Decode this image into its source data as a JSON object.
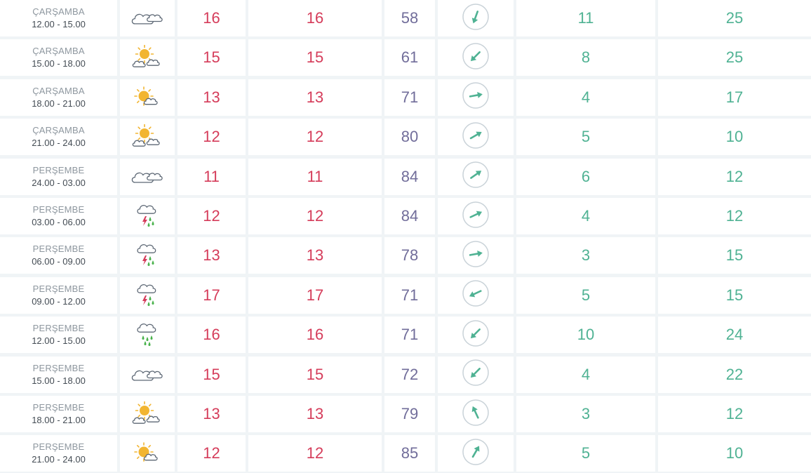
{
  "colors": {
    "temperature": "#d53c5a",
    "humidity": "#716d9a",
    "wind": "#4fb293",
    "sun": "#f2b531",
    "cloud_outline": "#5c6774",
    "rain": "#49b24b",
    "lightning": "#d53c5a"
  },
  "rows": [
    {
      "day": "ÇARŞAMBA",
      "hours": "12.00 - 15.00",
      "icon": "cloudy-icon",
      "temp": "16",
      "feels": "16",
      "humidity": "58",
      "wind_deg": 200,
      "wind": "11",
      "gust": "25"
    },
    {
      "day": "ÇARŞAMBA",
      "hours": "15.00 - 18.00",
      "icon": "partly-cloudy-icon",
      "temp": "15",
      "feels": "15",
      "humidity": "61",
      "wind_deg": 225,
      "wind": "8",
      "gust": "25"
    },
    {
      "day": "ÇARŞAMBA",
      "hours": "18.00 - 21.00",
      "icon": "sun-cloud-icon",
      "temp": "13",
      "feels": "13",
      "humidity": "71",
      "wind_deg": 80,
      "wind": "4",
      "gust": "17"
    },
    {
      "day": "ÇARŞAMBA",
      "hours": "21.00 - 24.00",
      "icon": "partly-cloudy-icon",
      "temp": "12",
      "feels": "12",
      "humidity": "80",
      "wind_deg": 60,
      "wind": "5",
      "gust": "10"
    },
    {
      "day": "PERŞEMBE",
      "hours": "24.00 - 03.00",
      "icon": "cloudy-icon",
      "temp": "11",
      "feels": "11",
      "humidity": "84",
      "wind_deg": 55,
      "wind": "6",
      "gust": "12"
    },
    {
      "day": "PERŞEMBE",
      "hours": "03.00 - 06.00",
      "icon": "thunder-rain-icon",
      "temp": "12",
      "feels": "12",
      "humidity": "84",
      "wind_deg": 65,
      "wind": "4",
      "gust": "12"
    },
    {
      "day": "PERŞEMBE",
      "hours": "06.00 - 09.00",
      "icon": "thunder-rain-icon",
      "temp": "13",
      "feels": "13",
      "humidity": "78",
      "wind_deg": 80,
      "wind": "3",
      "gust": "15"
    },
    {
      "day": "PERŞEMBE",
      "hours": "09.00 - 12.00",
      "icon": "thunder-rain-icon",
      "temp": "17",
      "feels": "17",
      "humidity": "71",
      "wind_deg": 245,
      "wind": "5",
      "gust": "15"
    },
    {
      "day": "PERŞEMBE",
      "hours": "12.00 - 15.00",
      "icon": "rain-icon",
      "temp": "16",
      "feels": "16",
      "humidity": "71",
      "wind_deg": 225,
      "wind": "10",
      "gust": "24"
    },
    {
      "day": "PERŞEMBE",
      "hours": "15.00 - 18.00",
      "icon": "cloudy-icon",
      "temp": "15",
      "feels": "15",
      "humidity": "72",
      "wind_deg": 225,
      "wind": "4",
      "gust": "22"
    },
    {
      "day": "PERŞEMBE",
      "hours": "18.00 - 21.00",
      "icon": "partly-cloudy-icon",
      "temp": "13",
      "feels": "13",
      "humidity": "79",
      "wind_deg": 335,
      "wind": "3",
      "gust": "12"
    },
    {
      "day": "PERŞEMBE",
      "hours": "21.00 - 24.00",
      "icon": "sun-cloud-icon",
      "temp": "12",
      "feels": "12",
      "humidity": "85",
      "wind_deg": 30,
      "wind": "5",
      "gust": "10"
    }
  ]
}
